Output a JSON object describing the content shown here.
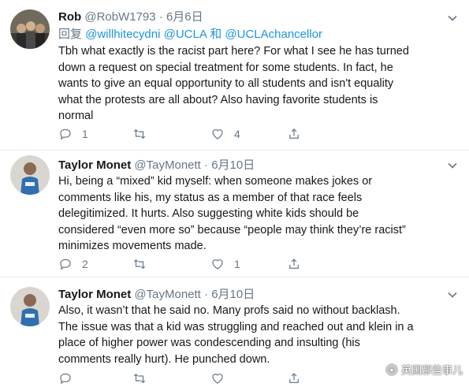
{
  "tweets": [
    {
      "name": "Rob",
      "handle": "@RobW1793",
      "date": "6月6日",
      "reply_prefix": "回复",
      "reply_mentions": [
        "@willhitecydni",
        "@UCLA"
      ],
      "reply_and": "和",
      "reply_last": "@UCLAchancellor",
      "body_lines": [
        "Tbh what exactly is the racist part here? For what I see he has turned",
        "down a request on special treatment for some students. In fact, he",
        "wants to give an equal opportunity to all students and isn't equality",
        "what the protests are all about? Also having favorite students is",
        "normal"
      ],
      "replies": "1",
      "retweets": "",
      "likes": "4"
    },
    {
      "name": "Taylor Monet",
      "handle": "@TayMonett",
      "date": "6月10日",
      "body_lines": [
        "Hi, being a “mixed” kid myself: when someone makes jokes or",
        "comments like his, my status as a member of that race feels",
        "delegitimized. It hurts.  Also suggesting white kids should be",
        "considered “even more so” because “people may think they’re racist”",
        "minimizes movements made."
      ],
      "replies": "2",
      "retweets": "",
      "likes": "1"
    },
    {
      "name": "Taylor Monet",
      "handle": "@TayMonett",
      "date": "6月10日",
      "body_lines": [
        "Also, it wasn’t that he said no. Many profs said no without backlash.",
        "The issue was that a kid was struggling and reached out and klein in a",
        "place of higher power was condescending and insulting (his",
        "comments really hurt). He punched down."
      ]
    }
  ],
  "watermark": "英国那些事儿",
  "colors": {
    "link": "#1b95e0",
    "muted": "#657786",
    "text": "#14171a",
    "divider": "#e6ecf0"
  }
}
